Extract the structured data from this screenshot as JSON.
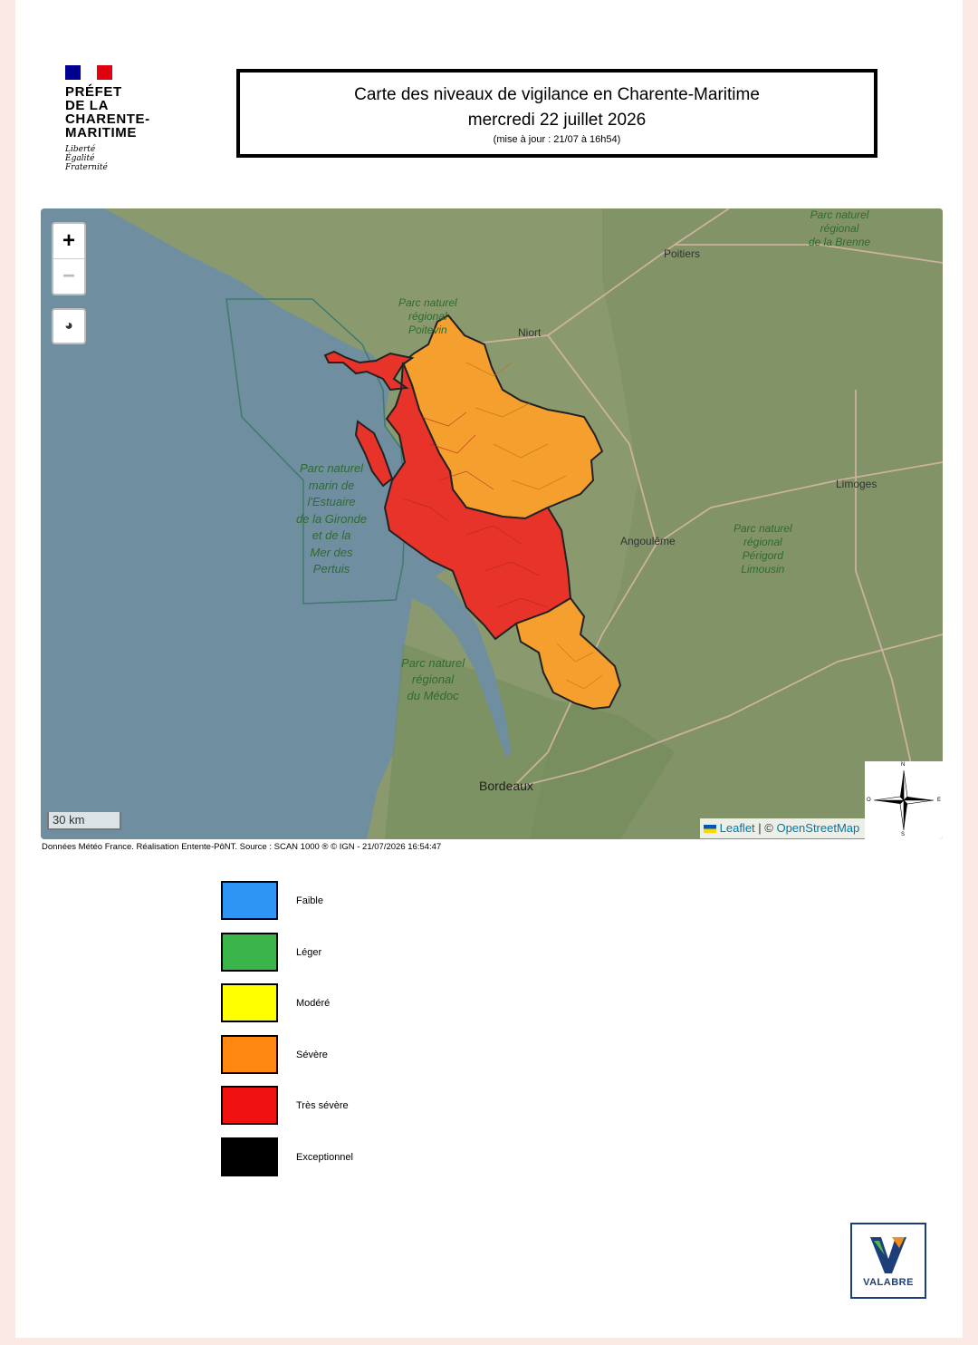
{
  "header": {
    "logo_lines": [
      "PRÉFET",
      "DE LA",
      "CHARENTE-",
      "MARITIME"
    ],
    "motto_lines": [
      "Liberté",
      "Égalité",
      "Fraternité"
    ],
    "flag_colors": [
      "#000091",
      "#ffffff",
      "#e1000f"
    ]
  },
  "title": {
    "line1": "Carte des niveaux de vigilance en Charente-Maritime",
    "line2": "mercredi 22 juillet 2026",
    "update": "(mise à jour : 21/07 à 16h54)"
  },
  "map": {
    "zoom_in": "+",
    "zoom_out": "−",
    "scale_label": "30 km",
    "attribution_leaflet": "Leaflet",
    "attribution_sep": " | © ",
    "attribution_osm": "OpenStreetMap",
    "compass": {
      "n": "N",
      "s": "S",
      "e": "E",
      "o": "O"
    },
    "cities": {
      "poitiers": "Poitiers",
      "niort": "Niort",
      "angouleme": "Angoulême",
      "limoges": "Limoges",
      "bordeaux": "Bordeaux"
    },
    "parks": {
      "brenne": [
        "Parc naturel",
        "régional",
        "de la Brenne"
      ],
      "poitevin": [
        "Parc naturel",
        "régional",
        "Poitevin"
      ],
      "estuaire": [
        "Parc naturel",
        "marin de",
        "l'Estuaire",
        "de la Gironde",
        "et de la",
        "Mer des",
        "Pertuis"
      ],
      "perigord": [
        "Parc naturel",
        "régional",
        "Périgord",
        "Limousin"
      ],
      "medoc": [
        "Parc naturel",
        "régional",
        "du Médoc"
      ]
    },
    "zone_colors": {
      "red": "#e8332a",
      "orange": "#f5a02e"
    }
  },
  "source": "Données Météo France. Réalisation Entente-PôNT. Source : SCAN 1000 ® © IGN - 21/07/2026 16:54:47",
  "legend": [
    {
      "label": "Faible",
      "color": "#2e95f5"
    },
    {
      "label": "Léger",
      "color": "#39b54a"
    },
    {
      "label": "Modéré",
      "color": "#ffff00"
    },
    {
      "label": "Sévère",
      "color": "#ff8812"
    },
    {
      "label": "Très sévère",
      "color": "#f01111"
    },
    {
      "label": "Exceptionnel",
      "color": "#000000"
    }
  ],
  "footer_logo": {
    "text": "VALABRE"
  }
}
